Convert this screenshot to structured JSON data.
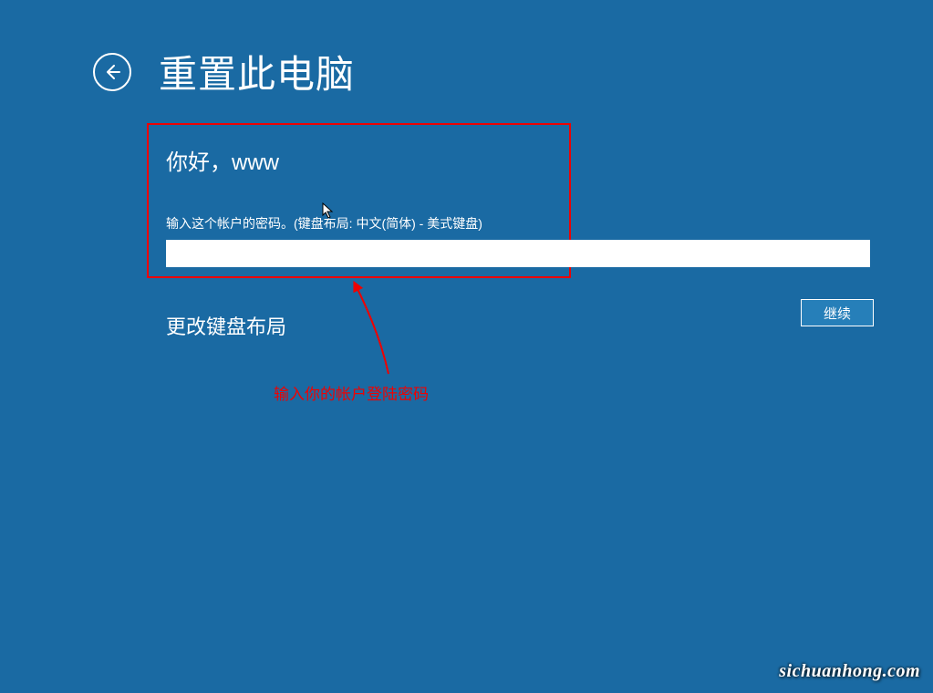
{
  "header": {
    "title": "重置此电脑"
  },
  "content": {
    "greeting": "你好，www",
    "password_label": "输入这个帐户的密码。(键盘布局: 中文(简体) - 美式键盘)",
    "password_value": "",
    "keyboard_layout_link": "更改键盘布局",
    "continue_button": "继续"
  },
  "annotation": {
    "text": "输入你的帐户登陆密码"
  },
  "watermark": "sichuanhong.com",
  "colors": {
    "background": "#1a6aa3",
    "annotation_red": "#ee0202",
    "button_bg": "#267fb9"
  }
}
